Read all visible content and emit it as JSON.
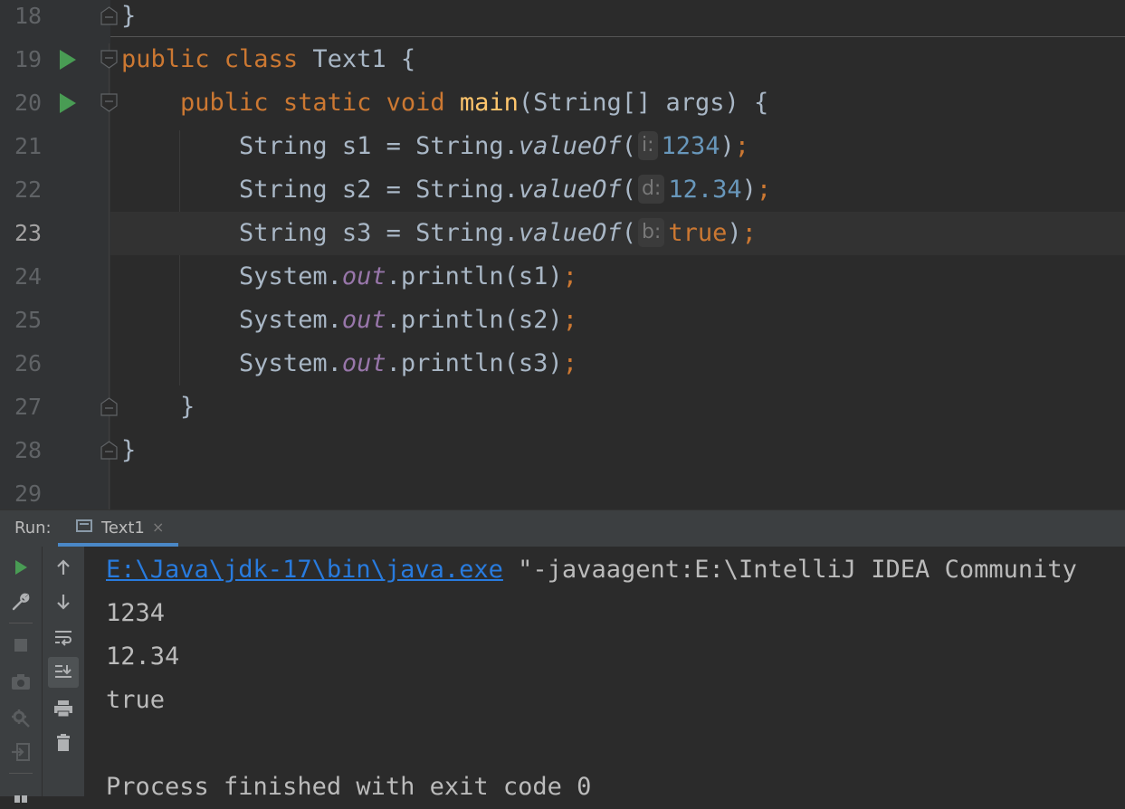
{
  "editor": {
    "lines": [
      {
        "num": "18",
        "tokens": [
          {
            "t": "}",
            "c": "plain"
          }
        ]
      },
      {
        "num": "19",
        "tokens": [
          {
            "t": "public ",
            "c": "kw"
          },
          {
            "t": "class ",
            "c": "kw"
          },
          {
            "t": "Text1 {",
            "c": "plain"
          }
        ]
      },
      {
        "num": "20",
        "tokens": [
          {
            "t": "    public ",
            "c": "kw"
          },
          {
            "t": "static ",
            "c": "kw"
          },
          {
            "t": "void ",
            "c": "kw"
          },
          {
            "t": "main",
            "c": "fn"
          },
          {
            "t": "(String[] args) {",
            "c": "plain"
          }
        ]
      },
      {
        "num": "21",
        "tokens": [
          {
            "t": "        String s1 = String.",
            "c": "plain"
          },
          {
            "t": "valueOf",
            "c": "static-m"
          },
          {
            "t": "(",
            "c": "plain"
          },
          {
            "t": "i:",
            "c": "hint"
          },
          {
            "t": "1234",
            "c": "num"
          },
          {
            "t": ")",
            "c": "plain"
          },
          {
            "t": ";",
            "c": "kw"
          }
        ]
      },
      {
        "num": "22",
        "tokens": [
          {
            "t": "        String s2 = String.",
            "c": "plain"
          },
          {
            "t": "valueOf",
            "c": "static-m"
          },
          {
            "t": "(",
            "c": "plain"
          },
          {
            "t": "d:",
            "c": "hint"
          },
          {
            "t": "12.34",
            "c": "num"
          },
          {
            "t": ")",
            "c": "plain"
          },
          {
            "t": ";",
            "c": "kw"
          }
        ]
      },
      {
        "num": "23",
        "tokens": [
          {
            "t": "        String s3 = String.",
            "c": "plain"
          },
          {
            "t": "valueOf",
            "c": "static-m"
          },
          {
            "t": "(",
            "c": "plain"
          },
          {
            "t": "b:",
            "c": "hint"
          },
          {
            "t": "true",
            "c": "kw"
          },
          {
            "t": ")",
            "c": "plain"
          },
          {
            "t": ";",
            "c": "kw"
          }
        ]
      },
      {
        "num": "24",
        "tokens": [
          {
            "t": "        System.",
            "c": "plain"
          },
          {
            "t": "out",
            "c": "field"
          },
          {
            "t": ".println(s1)",
            "c": "plain"
          },
          {
            "t": ";",
            "c": "kw"
          }
        ]
      },
      {
        "num": "25",
        "tokens": [
          {
            "t": "        System.",
            "c": "plain"
          },
          {
            "t": "out",
            "c": "field"
          },
          {
            "t": ".println(s2)",
            "c": "plain"
          },
          {
            "t": ";",
            "c": "kw"
          }
        ]
      },
      {
        "num": "26",
        "tokens": [
          {
            "t": "        System.",
            "c": "plain"
          },
          {
            "t": "out",
            "c": "field"
          },
          {
            "t": ".println(s3)",
            "c": "plain"
          },
          {
            "t": ";",
            "c": "kw"
          }
        ]
      },
      {
        "num": "27",
        "tokens": [
          {
            "t": "    }",
            "c": "plain"
          }
        ]
      },
      {
        "num": "28",
        "tokens": [
          {
            "t": "}",
            "c": "plain"
          }
        ]
      },
      {
        "num": "29",
        "tokens": []
      }
    ],
    "current_line": "23",
    "colors": {
      "background": "#2b2b2b",
      "keyword": "#cc7832",
      "function": "#ffc66d",
      "number": "#6897bb",
      "field": "#9876aa",
      "run_marker": "#499c54"
    }
  },
  "run_panel": {
    "label": "Run:",
    "tab": {
      "label": "Text1",
      "close": "×"
    },
    "toolbar_left": [
      "run-icon",
      "wrench-icon",
      "stop-icon",
      "camera-icon",
      "settings-debug-icon",
      "login-icon"
    ],
    "toolbar_right": [
      "arrow-up-icon",
      "arrow-down-icon",
      "soft-wrap-icon",
      "scroll-to-end-icon",
      "print-icon",
      "trash-icon"
    ],
    "console": {
      "command_link": "E:\\Java\\jdk-17\\bin\\java.exe",
      "command_rest": " \"-javaagent:E:\\IntelliJ IDEA Community",
      "output": [
        "1234",
        "12.34",
        "true",
        ""
      ],
      "exit_message": "Process finished with exit code 0"
    }
  }
}
